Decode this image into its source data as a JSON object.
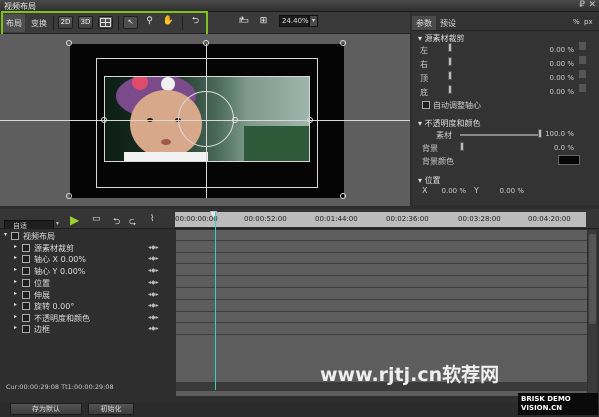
{
  "window": {
    "title": "视频布局",
    "pin": "₽",
    "close": "✕"
  },
  "toolbar": {
    "tabs": [
      "布局",
      "变换"
    ],
    "buttons": [
      "2D",
      "3D",
      "",
      "↖",
      "⚲",
      "✋",
      "⮌"
    ],
    "extra": [
      "↱",
      "▭",
      "⊞"
    ],
    "zoom": "24.40%"
  },
  "props": {
    "tabs": [
      "参数",
      "预设"
    ],
    "unit_icons": [
      "%",
      "px"
    ],
    "crop": {
      "title": "源素材裁剪",
      "rows": [
        {
          "label": "左",
          "value": "0.00 %"
        },
        {
          "label": "右",
          "value": "0.00 %"
        },
        {
          "label": "顶",
          "value": "0.00 %"
        },
        {
          "label": "底",
          "value": "0.00 %"
        }
      ],
      "auto": "自动调整轴心"
    },
    "opacity": {
      "title": "不透明度和颜色",
      "material_label": "素材",
      "material_value": "100.0 %",
      "bg_label": "背景",
      "bg_value": "0.0 %",
      "bgcolor_label": "背景颜色"
    },
    "position": {
      "title": "位置",
      "x_label": "X",
      "x_value": "0.00 %",
      "y_label": "Y",
      "y_value": "0.00 %"
    }
  },
  "timeline": {
    "mode": "自适",
    "ruler": [
      "00:00:00:00",
      "00:00:52:00",
      "00:01:44:00",
      "00:02:36:00",
      "00:03:28:00",
      "00:04:20:00"
    ],
    "tracks": [
      "视频布局",
      "源素材裁剪",
      "轴心 X  0.00%",
      "轴心 Y  0.00%",
      "位置",
      "伸展",
      "旋转  0.00°",
      "不透明度和颜色",
      "边框"
    ],
    "cursor": "Cur:00:00:29:08 Tt1:00:00:29:08"
  },
  "footer": {
    "save": "存为默认",
    "init": "初始化"
  },
  "watermark": {
    "site": "www.rjtj.cn软荐网",
    "brand": "BRISK DEMO VISION.CN"
  }
}
